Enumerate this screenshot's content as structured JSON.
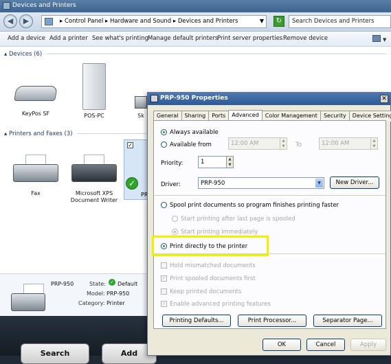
{
  "window": {
    "title": "Devices and Printers"
  },
  "address": {
    "crumbs": [
      "Control Panel",
      "Hardware and Sound",
      "Devices and Printers"
    ],
    "search_placeholder": "Search Devices and Printers"
  },
  "toolbar": {
    "items": [
      "Add a device",
      "Add a printer",
      "See what's printing",
      "Manage default printers",
      "Print server properties",
      "Remove device"
    ]
  },
  "devices": {
    "header": "Devices (6)",
    "items": [
      "KeyPos SF",
      "POS-PC",
      "Sk"
    ]
  },
  "printers": {
    "header": "Printers and Faxes (3)",
    "items": [
      "Fax",
      "Microsoft XPS Document Writer",
      "PR"
    ]
  },
  "details": {
    "name": "PRP-950",
    "state_label": "State:",
    "state_value": "Default",
    "model_label": "Model:",
    "model_value": "PRP-950",
    "category_label": "Category:",
    "category_value": "Printer"
  },
  "taskbar": {
    "buttons": [
      "Search",
      "Add"
    ]
  },
  "dialog": {
    "title": "PRP-950 Properties",
    "tabs": [
      "General",
      "Sharing",
      "Ports",
      "Advanced",
      "Color Management",
      "Security",
      "Device Settings"
    ],
    "active_tab": "Advanced",
    "always_available": "Always available",
    "available_from": "Available from",
    "time_from": "12:00 AM",
    "to_label": "To",
    "time_to": "12:00 AM",
    "priority_label": "Priority:",
    "priority_value": "1",
    "driver_label": "Driver:",
    "driver_value": "PRP-950",
    "new_driver": "New Driver...",
    "spool": "Spool print documents so program finishes printing faster",
    "spool_after_last": "Start printing after last page is spooled",
    "spool_immediately": "Start printing immediately",
    "print_directly": "Print directly to the printer",
    "hold_mismatched": "Hold mismatched documents",
    "print_spooled_first": "Print spooled documents first",
    "keep_printed": "Keep printed documents",
    "enable_advanced": "Enable advanced printing features",
    "printing_defaults": "Printing Defaults...",
    "print_processor": "Print Processor...",
    "separator_page": "Separator Page...",
    "ok": "OK",
    "cancel": "Cancel",
    "apply": "Apply"
  },
  "colors": {
    "highlight": "#f2ef00",
    "accent": "#2b5a96"
  }
}
